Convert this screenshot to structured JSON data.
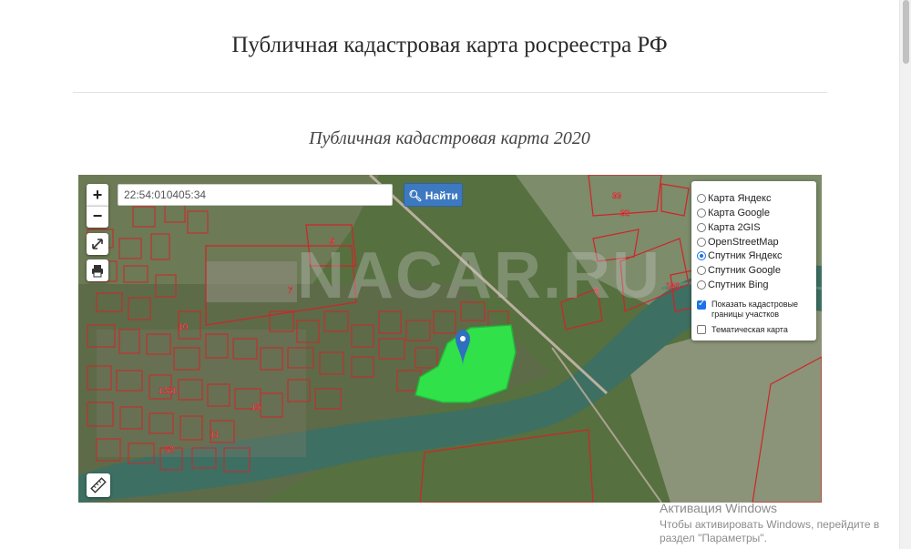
{
  "page": {
    "title": "Публичная кадастровая карта росреестра РФ",
    "subtitle": "Публичная кадастровая карта 2020"
  },
  "map": {
    "zoom_in": "+",
    "zoom_out": "−",
    "search": {
      "value": "22:54:010405:34",
      "button_label": "Найти"
    },
    "layers": {
      "options": [
        {
          "label": "Карта Яндекс",
          "selected": false
        },
        {
          "label": "Карта Google",
          "selected": false
        },
        {
          "label": "Карта 2GIS",
          "selected": false
        },
        {
          "label": "OpenStreetMap",
          "selected": false
        },
        {
          "label": "Спутник Яндекс",
          "selected": true
        },
        {
          "label": "Спутник Google",
          "selected": false
        },
        {
          "label": "Спутник Bing",
          "selected": false
        }
      ],
      "checkboxes": [
        {
          "label": "Показать кадастровые границы участков",
          "checked": true
        },
        {
          "label": "Тематическая карта",
          "checked": false
        }
      ]
    },
    "parcel_labels": [
      "9",
      "7",
      "10",
      "3",
      "33",
      "32",
      "140",
      "1281",
      "11",
      "15",
      "52"
    ],
    "accent": "#3d79c1",
    "parcel_highlight": "#2ee84a",
    "boundary_color": "#d0242a"
  },
  "watermark": "NACAR.RU",
  "activation": {
    "title": "Активация Windows",
    "text": "Чтобы активировать Windows, перейдите в раздел \"Параметры\"."
  }
}
